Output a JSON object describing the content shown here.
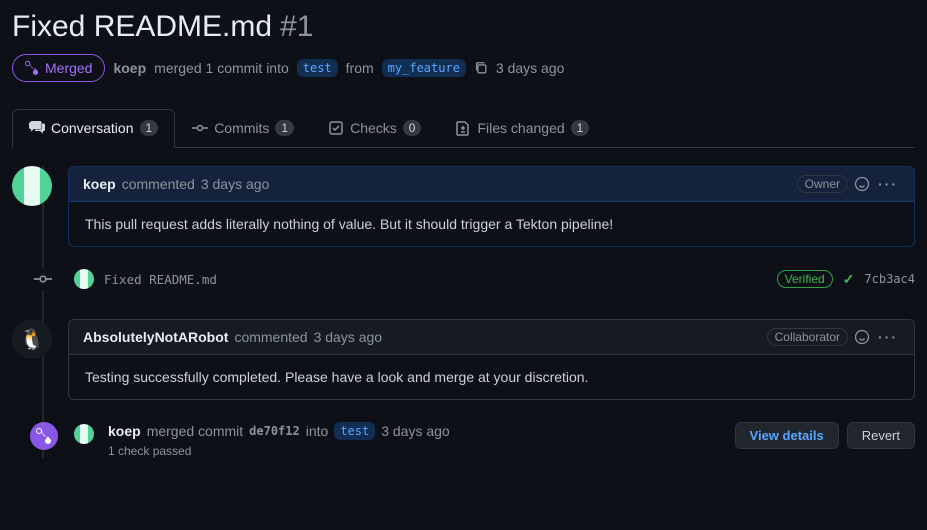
{
  "title": {
    "text": "Fixed README.md",
    "number": "#1"
  },
  "state_badge": "Merged",
  "meta": {
    "author": "koep",
    "action_text": "merged 1 commit into",
    "base_branch": "test",
    "from_word": "from",
    "head_branch": "my_feature",
    "time": "3 days ago"
  },
  "tabs": {
    "conversation": {
      "label": "Conversation",
      "count": "1"
    },
    "commits": {
      "label": "Commits",
      "count": "1"
    },
    "checks": {
      "label": "Checks",
      "count": "0"
    },
    "files": {
      "label": "Files changed",
      "count": "1"
    }
  },
  "comment1": {
    "author": "koep",
    "when_prefix": "commented",
    "when": "3 days ago",
    "role": "Owner",
    "body": "This pull request adds literally nothing of value. But it should trigger a Tekton pipeline!"
  },
  "commit_event": {
    "message": "Fixed README.md",
    "verified": "Verified",
    "sha": "7cb3ac4"
  },
  "comment2": {
    "author": "AbsolutelyNotARobot",
    "when_prefix": "commented",
    "when": "3 days ago",
    "role": "Collaborator",
    "body": "Testing successfully completed. Please have a look and merge at your discretion."
  },
  "merge_event": {
    "author": "koep",
    "text_before_sha": "merged commit",
    "sha": "de70f12",
    "into_word": "into",
    "branch": "test",
    "time": "3 days ago",
    "checks": "1 check passed",
    "view_details": "View details",
    "revert": "Revert"
  }
}
